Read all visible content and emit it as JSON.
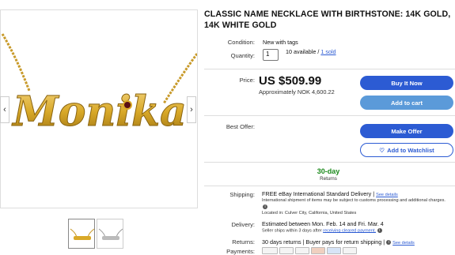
{
  "listing": {
    "title": "CLASSIC NAME NECKLACE WITH BIRTHSTONE: 14K GOLD, 14K WHITE GOLD",
    "image_text": "Monika"
  },
  "condition": {
    "label": "Condition:",
    "value": "New with tags"
  },
  "quantity": {
    "label": "Quantity:",
    "value": "1",
    "available": "10 available /",
    "sold": "1 sold"
  },
  "price": {
    "label": "Price:",
    "amount": "US $509.99",
    "approx": "Approximately NOK 4,600.22"
  },
  "buttons": {
    "buy_now": "Buy It Now",
    "add_to_cart": "Add to cart",
    "make_offer": "Make Offer",
    "watchlist": "Add to Watchlist"
  },
  "best_offer": {
    "label": "Best Offer:"
  },
  "returns_badge": {
    "days": "30-day",
    "text": "Returns"
  },
  "shipping": {
    "label": "Shipping:",
    "main": "FREE  eBay International Standard Delivery |",
    "details_link": "See details",
    "note": "International shipment of items may be subject to customs processing and additional charges.",
    "location": "Located in: Culver City, California, United States"
  },
  "delivery": {
    "label": "Delivery:",
    "main": "Estimated between Mon. Feb. 14 and Fri. Mar. 4",
    "note": "Seller ships within 3 days after",
    "note_link": "receiving cleared payment."
  },
  "returns": {
    "label": "Returns:",
    "text": "30 days returns | Buyer pays for return shipping |",
    "details_link": "See details"
  },
  "payments": {
    "label": "Payments:"
  },
  "colors": {
    "primary": "#2c5bd3",
    "secondary": "#5b9ad9",
    "green": "#1b8a1b",
    "gold": "#d9a928"
  }
}
